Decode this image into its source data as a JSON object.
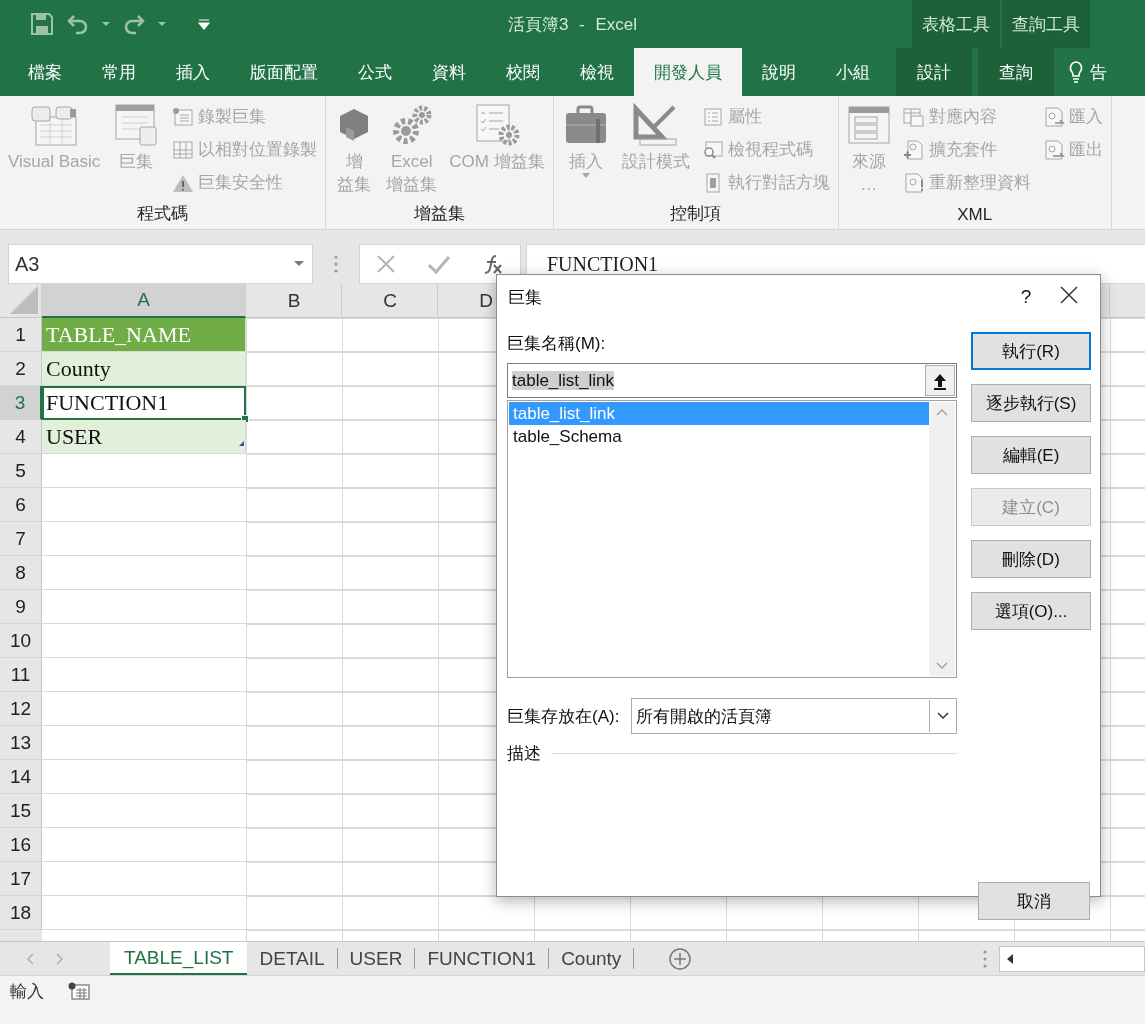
{
  "title_bar": {
    "title": "活頁簿3 - Excel",
    "context_labels": [
      "表格工具",
      "查詢工具"
    ]
  },
  "ribbon_tabs": [
    {
      "label": "檔案",
      "kind": "tab",
      "selected": false
    },
    {
      "label": "常用",
      "kind": "tab",
      "selected": false
    },
    {
      "label": "插入",
      "kind": "tab",
      "selected": false
    },
    {
      "label": "版面配置",
      "kind": "tab",
      "selected": false
    },
    {
      "label": "公式",
      "kind": "tab",
      "selected": false
    },
    {
      "label": "資料",
      "kind": "tab",
      "selected": false
    },
    {
      "label": "校閱",
      "kind": "tab",
      "selected": false
    },
    {
      "label": "檢視",
      "kind": "tab",
      "selected": false
    },
    {
      "label": "開發人員",
      "kind": "tab",
      "selected": true
    },
    {
      "label": "說明",
      "kind": "tab",
      "selected": false
    },
    {
      "label": "小組",
      "kind": "tab",
      "selected": false
    },
    {
      "label": "設計",
      "kind": "context",
      "selected": false
    },
    {
      "label": "查詢",
      "kind": "context",
      "selected": false
    },
    {
      "label": "告",
      "kind": "tell_me",
      "selected": false
    }
  ],
  "ribbon_groups": [
    {
      "title": "程式碼",
      "items": [
        {
          "kind": "large",
          "lines": [
            "Visual Basic"
          ],
          "disabled": true
        },
        {
          "kind": "large",
          "lines": [
            "巨集"
          ],
          "disabled": true
        },
        {
          "kind": "stack",
          "entries": [
            {
              "label": "錄製巨集",
              "disabled": true
            },
            {
              "label": "以相對位置錄製",
              "disabled": true
            },
            {
              "label": "巨集安全性",
              "disabled": true
            }
          ]
        }
      ]
    },
    {
      "title": "增益集",
      "items": [
        {
          "kind": "large",
          "lines": [
            "增",
            "益集"
          ],
          "disabled": true
        },
        {
          "kind": "large",
          "lines": [
            "Excel",
            "增益集"
          ],
          "disabled": true
        },
        {
          "kind": "large",
          "lines": [
            "COM 增益集"
          ],
          "disabled": true
        }
      ]
    },
    {
      "title": "控制項",
      "items": [
        {
          "kind": "large",
          "lines": [
            "插入"
          ],
          "disabled": true,
          "has_menu": true
        },
        {
          "kind": "large",
          "lines": [
            "設計模式"
          ],
          "disabled": true
        },
        {
          "kind": "stack",
          "entries": [
            {
              "label": "屬性",
              "disabled": true
            },
            {
              "label": "檢視程式碼",
              "disabled": true
            },
            {
              "label": "執行對話方塊",
              "disabled": true
            }
          ]
        }
      ]
    },
    {
      "title": "XML",
      "items": [
        {
          "kind": "large",
          "lines": [
            "來源",
            "…"
          ],
          "disabled": true
        },
        {
          "kind": "stack",
          "entries": [
            {
              "label": "對應內容",
              "disabled": true
            },
            {
              "label": "擴充套件",
              "disabled": true
            },
            {
              "label": "重新整理資料",
              "disabled": true
            }
          ]
        },
        {
          "kind": "stack",
          "entries": [
            {
              "label": "匯入",
              "disabled": true
            },
            {
              "label": "匯出",
              "disabled": true
            }
          ]
        }
      ]
    }
  ],
  "formula_bar": {
    "name_box": "A3",
    "formula": "FUNCTION1"
  },
  "sheet": {
    "columns": [
      {
        "label": "A",
        "selected": true
      },
      {
        "label": "B",
        "selected": false
      },
      {
        "label": "C",
        "selected": false
      },
      {
        "label": "D",
        "selected": false
      }
    ],
    "rows": [
      {
        "label": "1",
        "selected": false
      },
      {
        "label": "2",
        "selected": false
      },
      {
        "label": "3",
        "selected": true
      },
      {
        "label": "4",
        "selected": false
      },
      {
        "label": "5",
        "selected": false
      },
      {
        "label": "6",
        "selected": false
      },
      {
        "label": "7",
        "selected": false
      },
      {
        "label": "8",
        "selected": false
      },
      {
        "label": "9",
        "selected": false
      },
      {
        "label": "10",
        "selected": false
      },
      {
        "label": "11",
        "selected": false
      },
      {
        "label": "12",
        "selected": false
      },
      {
        "label": "13",
        "selected": false
      },
      {
        "label": "14",
        "selected": false
      },
      {
        "label": "15",
        "selected": false
      },
      {
        "label": "16",
        "selected": false
      },
      {
        "label": "17",
        "selected": false
      },
      {
        "label": "18",
        "selected": false
      }
    ],
    "cells": [
      {
        "text": "TABLE_NAME",
        "kind": "header",
        "active": false
      },
      {
        "text": "County",
        "kind": "band",
        "active": false
      },
      {
        "text": "FUNCTION1",
        "kind": "plain",
        "active": true
      },
      {
        "text": "USER",
        "kind": "band",
        "active": false
      }
    ]
  },
  "sheet_tabs": [
    {
      "label": "TABLE_LIST",
      "selected": true
    },
    {
      "label": "DETAIL",
      "selected": false
    },
    {
      "label": "USER",
      "selected": false
    },
    {
      "label": "FUNCTION1",
      "selected": false
    },
    {
      "label": "County",
      "selected": false
    }
  ],
  "status_bar": {
    "mode": "輸入"
  },
  "dialog": {
    "title": "巨集",
    "help": "?",
    "name_label": "巨集名稱(M):",
    "name_value": "table_list_link",
    "macros": [
      {
        "name": "table_list_link",
        "selected": true
      },
      {
        "name": "table_Schema",
        "selected": false
      }
    ],
    "location_label": "巨集存放在(A):",
    "location_value": "所有開啟的活頁簿",
    "description_label": "描述",
    "buttons": [
      {
        "label": "執行(R)",
        "kind": "action",
        "default": true,
        "disabled": false
      },
      {
        "label": "逐步執行(S)",
        "kind": "action",
        "default": false,
        "disabled": false
      },
      {
        "label": "編輯(E)",
        "kind": "action",
        "default": false,
        "disabled": false
      },
      {
        "label": "建立(C)",
        "kind": "action",
        "default": false,
        "disabled": true
      },
      {
        "label": "刪除(D)",
        "kind": "action",
        "default": false,
        "disabled": false
      },
      {
        "label": "選項(O)...",
        "kind": "action",
        "default": false,
        "disabled": false
      },
      {
        "label": "取消",
        "kind": "cancel",
        "default": false,
        "disabled": false
      }
    ]
  }
}
